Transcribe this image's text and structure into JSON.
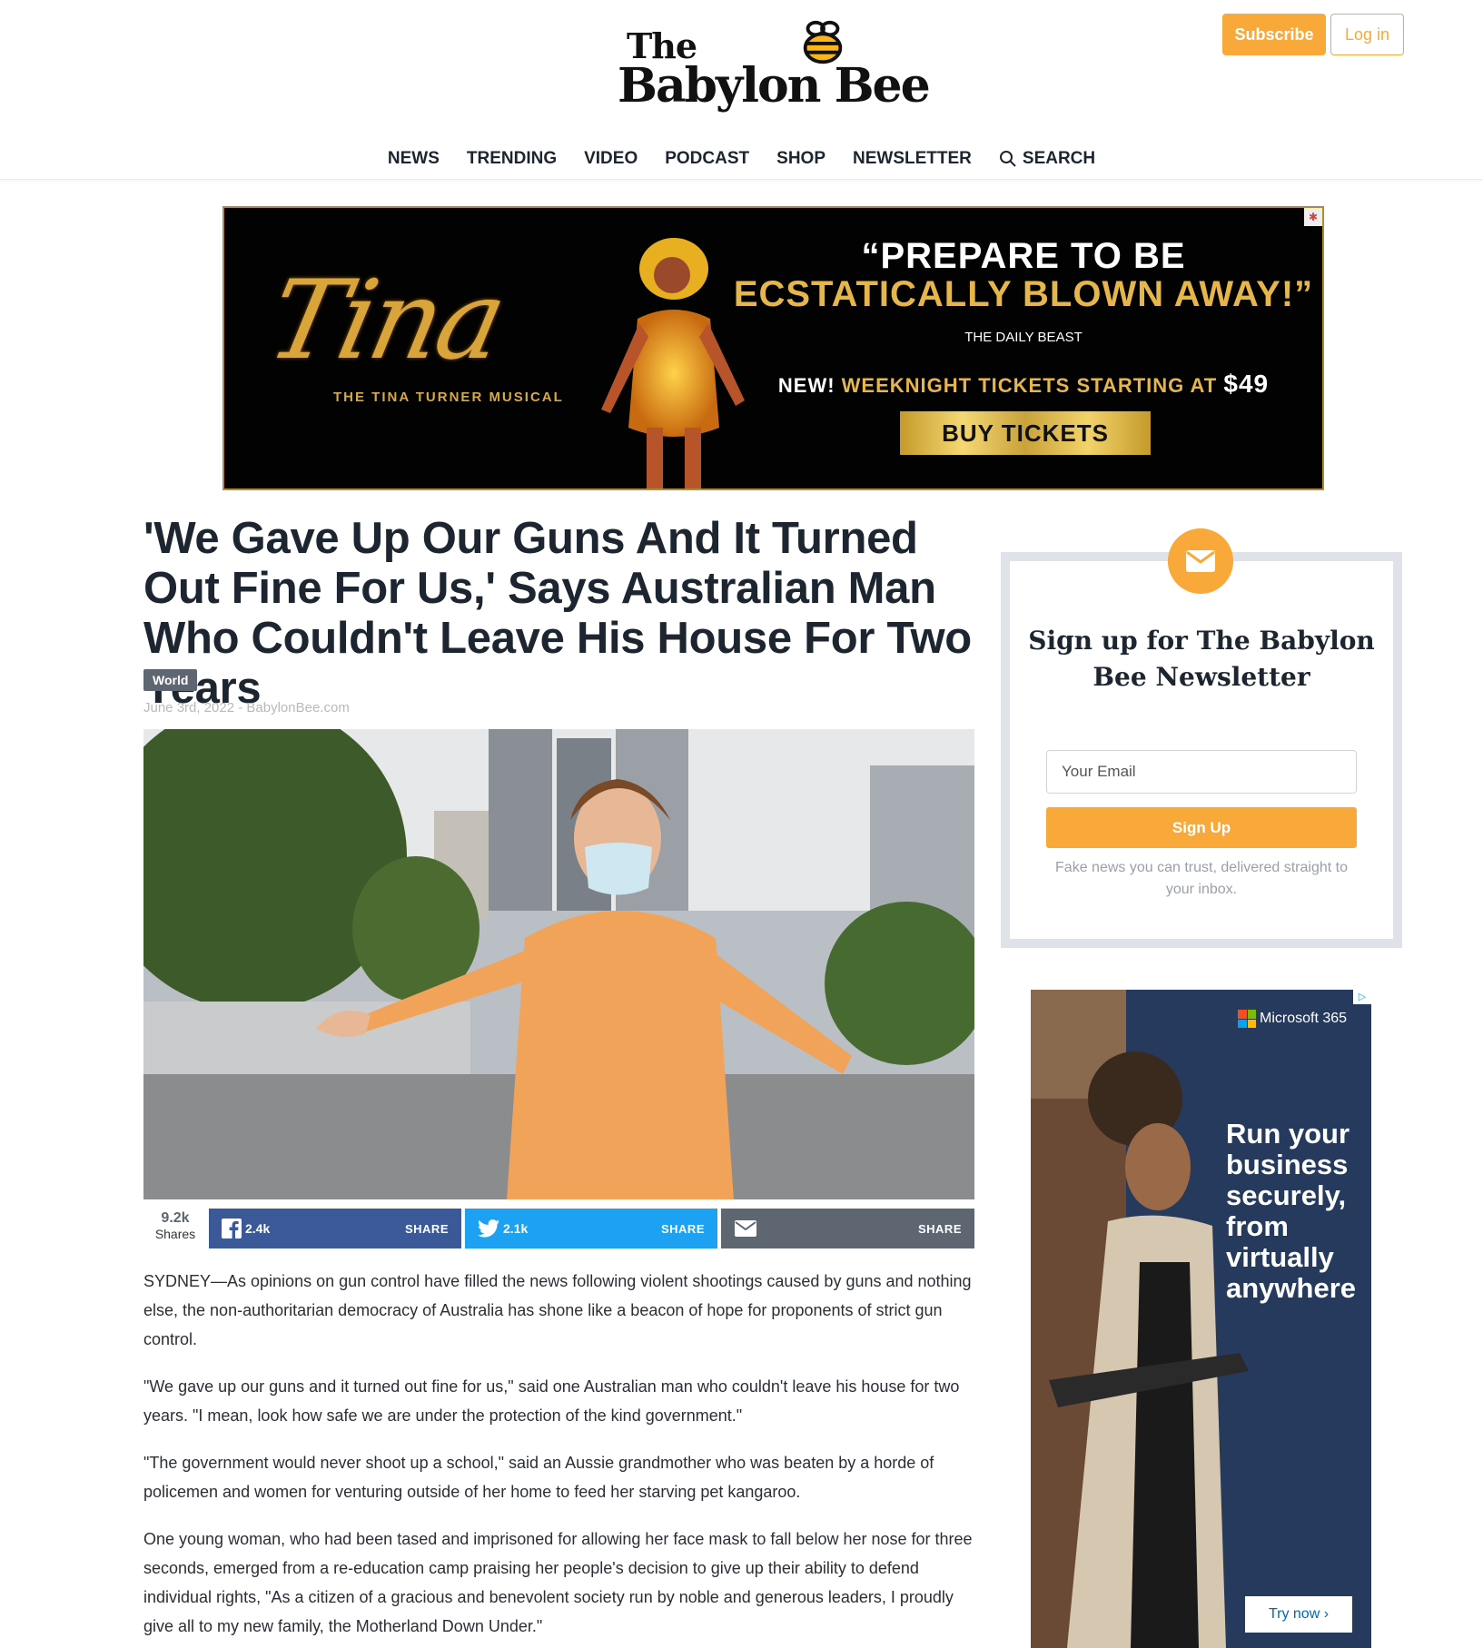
{
  "header": {
    "logo_the": "The",
    "logo_name": "Babylon Bee",
    "subscribe_label": "Subscribe",
    "login_label": "Log in",
    "nav": [
      "NEWS",
      "TRENDING",
      "VIDEO",
      "PODCAST",
      "SHOP",
      "NEWSLETTER"
    ],
    "search_label": "SEARCH"
  },
  "ad_top": {
    "title": "Tina",
    "subtitle": "THE TINA TURNER MUSICAL",
    "quote_line1": "“PREPARE TO BE",
    "quote_line2": "ECSTATICALLY BLOWN AWAY!”",
    "source": "THE DAILY BEAST",
    "tickets_prefix": "NEW!",
    "tickets_text": "WEEKNIGHT TICKETS STARTING AT",
    "tickets_price": "$49",
    "buy_label": "BUY TICKETS"
  },
  "article": {
    "headline": "'We Gave Up Our Guns And It Turned Out Fine For Us,' Says Australian Man Who Couldn't Leave His House For Two Years",
    "category": "World",
    "byline": "June 3rd, 2022 - BabylonBee.com",
    "share": {
      "total": "9.2k",
      "total_label": "Shares",
      "facebook_count": "2.4k",
      "twitter_count": "2.1k",
      "share_label": "SHARE"
    },
    "paragraphs": [
      "SYDNEY—As opinions on gun control have filled the news following violent shootings caused by guns and nothing else, the non-authoritarian democracy of Australia has shone like a beacon of hope for proponents of strict gun control.",
      "\"We gave up our guns and it turned out fine for us,\" said one Australian man who couldn't leave his house for two years. \"I mean, look how safe we are under the protection of the kind government.\"",
      "\"The government would never shoot up a school,\" said an Aussie grandmother who was beaten by a horde of policemen and women for venturing outside of her home to feed her starving pet kangaroo.",
      "One young woman, who had been tased and imprisoned for allowing her face mask to fall below her nose for three seconds, emerged from a re-education camp praising her people's decision to give up their ability to defend individual rights, \"As a citizen of a gracious and benevolent society run by noble and generous leaders, I proudly give all to my new family, the Motherland Down Under.\""
    ]
  },
  "newsletter": {
    "title": "Sign up for The Babylon Bee Newsletter",
    "email_placeholder": "Your Email",
    "signup_label": "Sign Up",
    "note": "Fake news you can trust, delivered straight to your inbox."
  },
  "ad_side": {
    "brand": "Microsoft 365",
    "headline": "Run your business securely, from virtually anywhere",
    "cta": "Try now ›"
  },
  "colors": {
    "accent": "#f9a93a",
    "facebook": "#3b5998",
    "twitter": "#1da1f2",
    "email": "#5e6671",
    "heading": "#1d2530"
  }
}
